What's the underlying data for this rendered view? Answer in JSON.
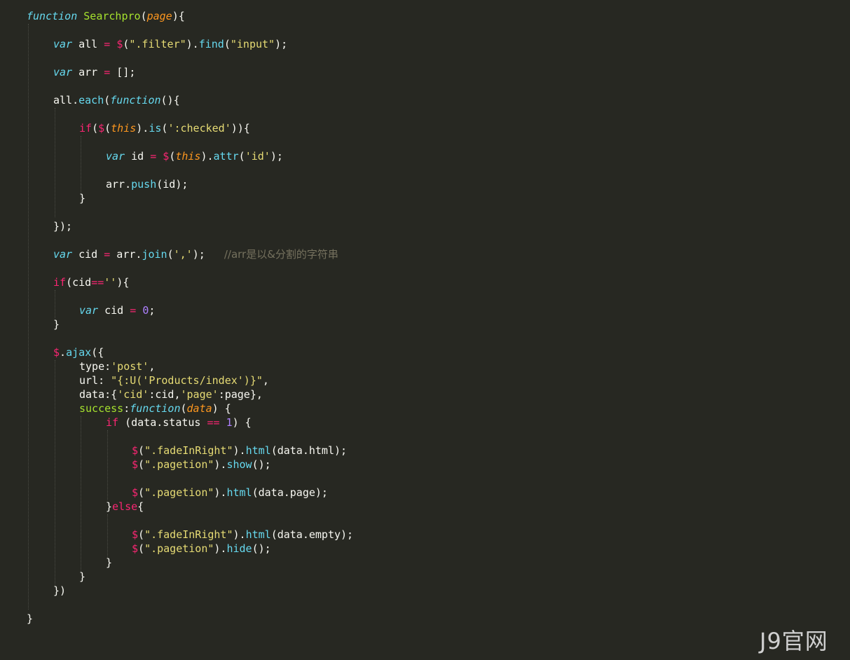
{
  "code": {
    "l1": [
      "function",
      " ",
      "Searchpro",
      "(",
      "page",
      "){"
    ],
    "l2": [
      "var",
      " all ",
      "=",
      " ",
      "$",
      "(",
      "\".filter\"",
      ").",
      "find",
      "(",
      "\"input\"",
      ");"
    ],
    "l3": [
      "var",
      " arr ",
      "=",
      " [];"
    ],
    "l4": [
      "all.",
      "each",
      "(",
      "function",
      "(){"
    ],
    "l5": [
      "if",
      "(",
      "$",
      "(",
      "this",
      ").",
      "is",
      "(",
      "':checked'",
      ")){"
    ],
    "l6": [
      "var",
      " id ",
      "=",
      " ",
      "$",
      "(",
      "this",
      ").",
      "attr",
      "(",
      "'id'",
      ");"
    ],
    "l7": [
      "arr.",
      "push",
      "(id);"
    ],
    "l8": [
      "}"
    ],
    "l9": [
      "});"
    ],
    "l10": [
      "var",
      " cid ",
      "=",
      " arr.",
      "join",
      "(",
      "','",
      ");",
      "   ",
      "//arr是以&分割的字符串"
    ],
    "l11": [
      "if",
      "(cid",
      "==",
      "''",
      "){"
    ],
    "l12": [
      "var",
      " cid ",
      "=",
      " ",
      "0",
      ";"
    ],
    "l13": [
      "}"
    ],
    "l14": [
      "$",
      ".",
      "ajax",
      "({"
    ],
    "l15": [
      "type:",
      "'post'",
      ","
    ],
    "l16": [
      "url: ",
      "\"{:U('Products/index')}\"",
      ","
    ],
    "l17": [
      "data:{",
      "'cid'",
      ":cid,",
      "'page'",
      ":page},"
    ],
    "l18": [
      "success",
      ":",
      "function",
      "(",
      "data",
      ") {"
    ],
    "l19": [
      "if",
      " (data.status ",
      "==",
      " ",
      "1",
      ") {"
    ],
    "l20": [
      "$",
      "(",
      "\".fadeInRight\"",
      ").",
      "html",
      "(data.html);"
    ],
    "l21": [
      "$",
      "(",
      "\".pagetion\"",
      ").",
      "show",
      "();"
    ],
    "l22": [
      "$",
      "(",
      "\".pagetion\"",
      ").",
      "html",
      "(data.page);"
    ],
    "l23": [
      "}",
      "else",
      "{"
    ],
    "l24": [
      "$",
      "(",
      "\".fadeInRight\"",
      ").",
      "html",
      "(data.empty);"
    ],
    "l25": [
      "$",
      "(",
      "\".pagetion\"",
      ").",
      "hide",
      "();"
    ],
    "l26": [
      "}"
    ],
    "l27": [
      "}"
    ],
    "l28": [
      "})"
    ],
    "l29": [
      "}"
    ]
  },
  "watermark": "J9官网",
  "colors": {
    "background": "#272822",
    "keyword_storage": "#66d9ef",
    "keyword": "#f92672",
    "function_name": "#a6e22e",
    "parameter": "#fd971f",
    "string": "#e6db74",
    "number": "#ae81ff",
    "comment": "#75715e"
  }
}
